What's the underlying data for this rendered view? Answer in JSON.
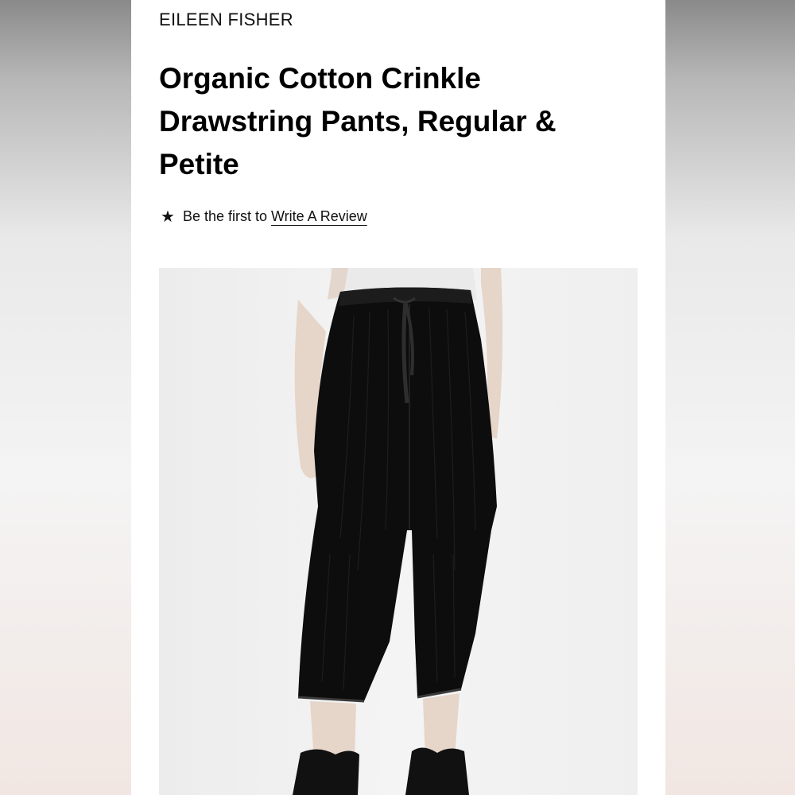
{
  "product": {
    "brand": "EILEEN FISHER",
    "title": "Organic Cotton Crinkle Drawstring Pants, Regular & Petite",
    "image_alt": "Organic Cotton Crinkle Drawstring Pants, Regular & Petite"
  },
  "reviews": {
    "star_icon": "star-icon",
    "prefix_text": "Be the first to",
    "link_text": "Write A Review"
  },
  "colors": {
    "page_background": "#ffffff",
    "text": "#111111",
    "pants": "#0d0d0d"
  }
}
